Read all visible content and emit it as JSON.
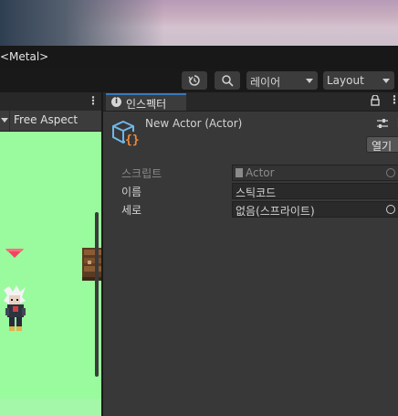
{
  "window": {
    "title_fragment": "<Metal>"
  },
  "toolbar": {
    "history_icon": "history-icon",
    "search_icon": "search-icon",
    "layers_label": "레이어",
    "layout_label": "Layout"
  },
  "game": {
    "aspect_label": "Free Aspect",
    "background_color": "#99fb9d"
  },
  "inspector": {
    "tab_label": "인스펙터",
    "object_name": "New Actor (Actor)",
    "open_button_label": "열기",
    "rows": [
      {
        "label": "스크립트",
        "value": "Actor"
      },
      {
        "label": "이름",
        "value": "스틱코드"
      },
      {
        "label": "세로",
        "value": "없음(스프라이트)"
      }
    ]
  },
  "colors": {
    "accent": "#3a79bb",
    "icon_blue": "#6fb6e8",
    "icon_orange": "#f08a3c"
  }
}
